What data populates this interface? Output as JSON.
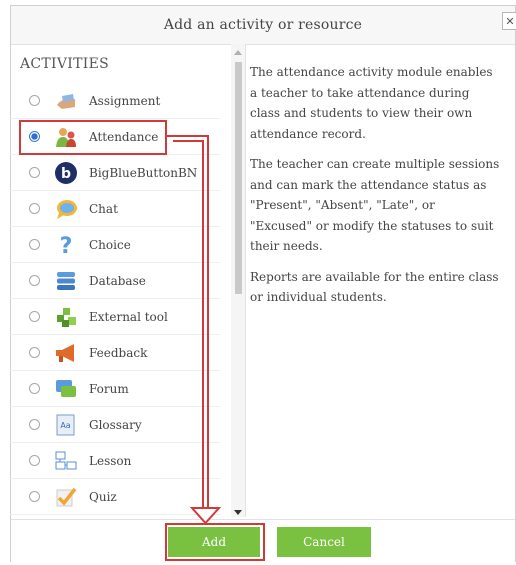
{
  "dialog": {
    "title": "Add an activity or resource",
    "close_label": "✕"
  },
  "activities": {
    "heading": "ACTIVITIES",
    "items": [
      {
        "label": "Assignment",
        "icon": "assignment-icon",
        "selected": false
      },
      {
        "label": "Attendance",
        "icon": "attendance-icon",
        "selected": true
      },
      {
        "label": "BigBlueButtonBN",
        "icon": "bigbluebutton-icon",
        "selected": false
      },
      {
        "label": "Chat",
        "icon": "chat-icon",
        "selected": false
      },
      {
        "label": "Choice",
        "icon": "choice-icon",
        "selected": false
      },
      {
        "label": "Database",
        "icon": "database-icon",
        "selected": false
      },
      {
        "label": "External tool",
        "icon": "external-tool-icon",
        "selected": false
      },
      {
        "label": "Feedback",
        "icon": "feedback-icon",
        "selected": false
      },
      {
        "label": "Forum",
        "icon": "forum-icon",
        "selected": false
      },
      {
        "label": "Glossary",
        "icon": "glossary-icon",
        "selected": false
      },
      {
        "label": "Lesson",
        "icon": "lesson-icon",
        "selected": false
      },
      {
        "label": "Quiz",
        "icon": "quiz-icon",
        "selected": false
      }
    ]
  },
  "description": {
    "paragraphs": [
      "The attendance activity module enables a teacher to take attendance during class and students to view their own attendance record.",
      "The teacher can create multiple sessions and can mark the attendance status as \"Present\", \"Absent\", \"Late\", or \"Excused\" or modify the statuses to suit their needs.",
      "Reports are available for the entire class or individual students."
    ]
  },
  "footer": {
    "add_label": "Add",
    "cancel_label": "Cancel"
  },
  "colors": {
    "button_green": "#7ac142",
    "highlight_red": "#d23a3a",
    "radio_blue": "#2f6fcf"
  }
}
